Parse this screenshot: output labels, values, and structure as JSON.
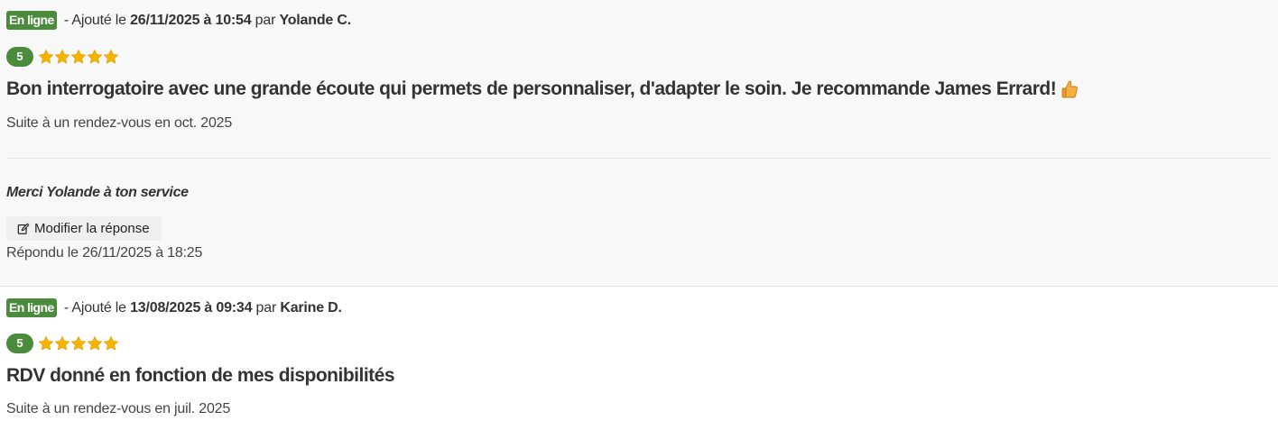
{
  "reviews": [
    {
      "status_badge": "En ligne",
      "added_prefix": " - Ajouté le ",
      "added_datetime": "26/11/2025 à 10:54",
      "by_prefix": " par ",
      "author": "Yolande C.",
      "score": "5",
      "stars": 5,
      "star_color": "#f5b400",
      "headline": "Bon interrogatoire avec une grande écoute qui permets de personnaliser, d'adapter le soin. Je recommande James Errard!",
      "headline_emoji_icon": "thumbs-up-icon",
      "visit_text": "Suite à un rendez-vous en oct. 2025",
      "reply": {
        "text": "Merci Yolande à ton service",
        "edit_button_label": "Modifier la réponse",
        "replied_text": "Répondu le 26/11/2025 à 18:25"
      }
    },
    {
      "status_badge": "En ligne",
      "added_prefix": " - Ajouté le ",
      "added_datetime": "13/08/2025 à 09:34",
      "by_prefix": " par ",
      "author": "Karine D.",
      "score": "5",
      "stars": 5,
      "star_color": "#f5b400",
      "headline": "RDV donné en fonction de mes disponibilités",
      "visit_text": "Suite à un rendez-vous en juil. 2025"
    }
  ],
  "colors": {
    "badge_green": "#4a8b3c",
    "star_yellow": "#f5b400"
  }
}
